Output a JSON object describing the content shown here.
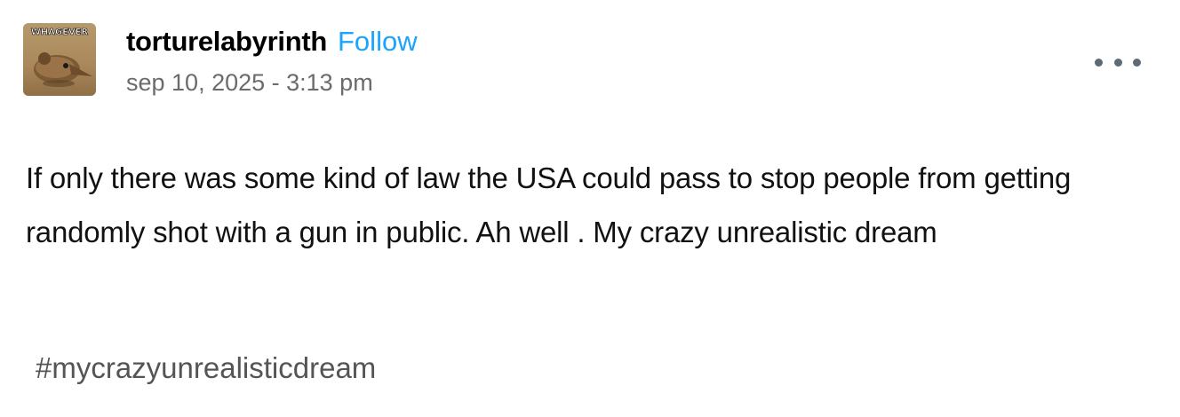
{
  "post": {
    "avatar_text": "WHAGEVER",
    "avatar_icon": "elephant-shrew-avatar",
    "username": "torturelabyrinth",
    "follow_label": "Follow",
    "timestamp": "sep 10, 2025 - 3:13 pm",
    "more_icon": "ellipsis-icon",
    "body": "If only there was some kind of law the USA could pass to stop people from getting randomly shot with a gun in public. Ah well . My crazy unrealistic dream",
    "tags": [
      "#mycrazyunrealisticdream"
    ]
  },
  "colors": {
    "follow": "#1aa3ff",
    "timestamp": "#6b6b6b",
    "tag": "#555555",
    "more_dots": "#5e6a74"
  }
}
